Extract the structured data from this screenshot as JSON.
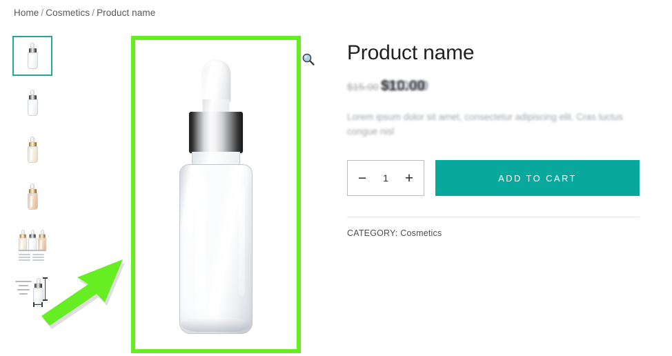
{
  "breadcrumb": {
    "items": [
      "Home",
      "Cosmetics",
      "Product name"
    ],
    "separator": "/"
  },
  "gallery": {
    "zoom_icon_name": "magnifier-zoom-icon",
    "selected_index": 0,
    "highlight_color": "#66ee22",
    "selected_border_color": "#26a69a",
    "thumbnails": [
      {
        "label": "Clear dropper bottle",
        "kind": "bottle",
        "tone": "clear"
      },
      {
        "label": "White dropper bottle",
        "kind": "bottle",
        "tone": "clear"
      },
      {
        "label": "Cream dropper bottle",
        "kind": "bottle",
        "tone": "cream"
      },
      {
        "label": "Peach dropper bottle",
        "kind": "bottle",
        "tone": "peach"
      },
      {
        "label": "Bottle color range",
        "kind": "group",
        "tone": "mixed"
      },
      {
        "label": "Bottle dimensions diagram",
        "kind": "spec",
        "tone": "clear"
      }
    ],
    "main_image_alt": "Clear glass serum dropper bottle with silver collar and white cap"
  },
  "product": {
    "title": "Product name",
    "price_old": "$15.00",
    "price_new": "$10.00",
    "price_ghost": "$10.00",
    "description": "Lorem ipsum dolor sit amet, consectetur adipiscing elit. Cras luctus congue nisl",
    "quantity": {
      "decrement_label": "−",
      "value": "1",
      "increment_label": "+"
    },
    "add_to_cart_label": "ADD TO CART",
    "add_to_cart_color": "#08a89d",
    "category_label": "CATEGORY:",
    "category_value": "Cosmetics"
  },
  "annotation": {
    "arrow_color": "#66ee22",
    "arrow_points_to": "main-product-image"
  }
}
